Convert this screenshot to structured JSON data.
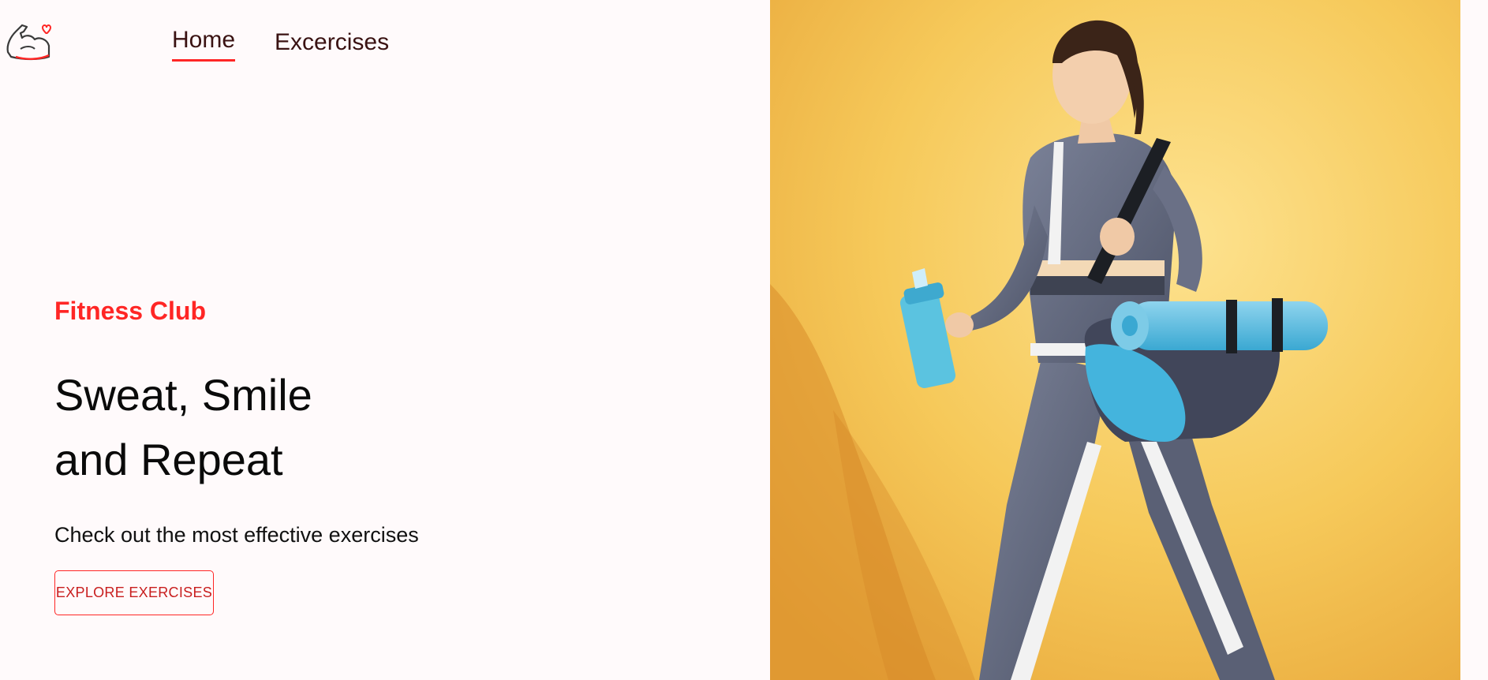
{
  "nav": {
    "items": [
      {
        "label": "Home",
        "active": true
      },
      {
        "label": "Excercises",
        "active": false
      }
    ],
    "accent_color": "#ff2625"
  },
  "hero": {
    "brand": "Fitness Club",
    "headline_line1": "Sweat, Smile",
    "headline_line2": "and Repeat",
    "subtitle": "Check out the most effective exercises",
    "cta_label": "EXPLORE EXERCISES"
  },
  "banner": {
    "background_color": "#f7c95c",
    "icon": "woman-with-gym-bag-photo"
  },
  "logo": {
    "icon": "flexed-arm-heart-icon"
  }
}
